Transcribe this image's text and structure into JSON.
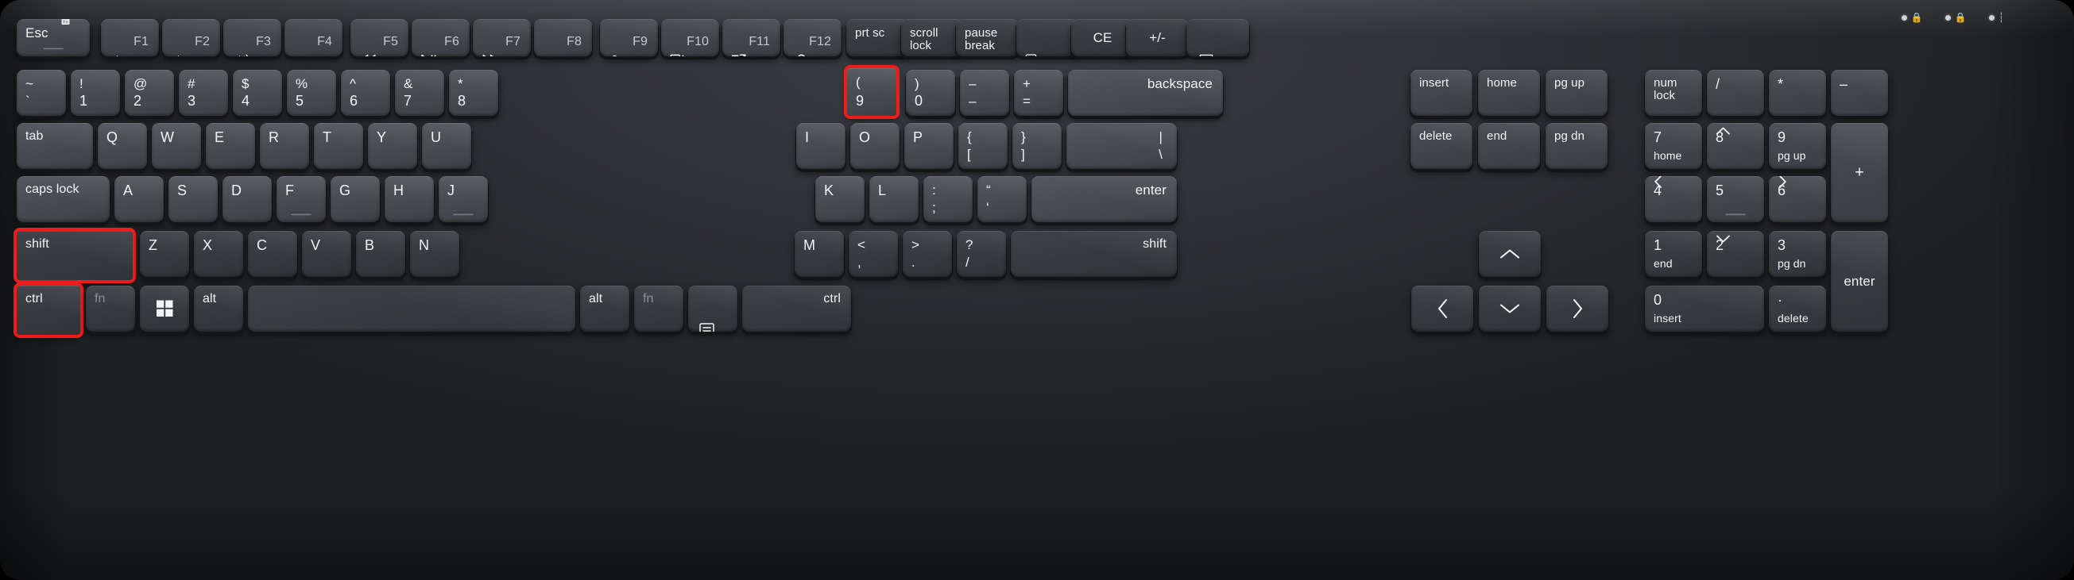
{
  "device": {
    "name": "full-size-desktop-keyboard",
    "layout": "ansi-104-with-numpad",
    "colors": {
      "chassis": "#303338",
      "keycap": "#4a4d53",
      "keycap_bezel": "#141517",
      "legend": "#f2f4f5",
      "legend_dim": "#8d9195",
      "highlight": "#f01c1c",
      "led": "#cfd3d6"
    }
  },
  "indicators": [
    {
      "name": "caps-lock-led",
      "glyph": "lock",
      "lit": false
    },
    {
      "name": "num-lock-led",
      "glyph": "lock",
      "lit": false
    },
    {
      "name": "scroll-lock-led",
      "glyph": "bar",
      "lit": false
    }
  ],
  "highlighted_keys": [
    "9",
    "shift",
    "ctrl"
  ],
  "function_row": [
    {
      "name": "escape",
      "primary": "Esc",
      "secondary": "",
      "icon": "fn-lock-icon",
      "homing": true
    },
    {
      "name": "f1",
      "primary": "",
      "secondary": "F1",
      "icon": "volume-mute-icon"
    },
    {
      "name": "f2",
      "primary": "",
      "secondary": "F2",
      "icon": "volume-down-icon"
    },
    {
      "name": "f3",
      "primary": "",
      "secondary": "F3",
      "icon": "volume-up-icon"
    },
    {
      "name": "f4",
      "primary": "",
      "secondary": "F4",
      "icon": ""
    },
    {
      "name": "f5",
      "primary": "",
      "secondary": "F5",
      "icon": "rewind-icon"
    },
    {
      "name": "f6",
      "primary": "",
      "secondary": "F6",
      "icon": "play-pause-icon"
    },
    {
      "name": "f7",
      "primary": "",
      "secondary": "F7",
      "icon": "fast-forward-icon"
    },
    {
      "name": "f8",
      "primary": "",
      "secondary": "F8",
      "icon": ""
    },
    {
      "name": "f9",
      "primary": "",
      "secondary": "F9",
      "icon": "lock-icon"
    },
    {
      "name": "f10",
      "primary": "",
      "secondary": "F10",
      "icon": "project-panel-icon"
    },
    {
      "name": "f11",
      "primary": "",
      "secondary": "F11",
      "icon": "screen-snip-icon"
    },
    {
      "name": "f12",
      "primary": "",
      "secondary": "F12",
      "icon": "search-icon"
    },
    {
      "name": "print-screen",
      "primary": "prt sc",
      "secondary": "",
      "icon": ""
    },
    {
      "name": "scroll-lock",
      "primary": "scroll\nlock",
      "secondary": "",
      "icon": ""
    },
    {
      "name": "pause-break",
      "primary": "pause\nbreak",
      "secondary": "",
      "icon": ""
    },
    {
      "name": "calculator",
      "primary": "",
      "secondary": "",
      "icon": "calculator-icon"
    },
    {
      "name": "clear-entry",
      "primary": "CE",
      "secondary": "",
      "icon": ""
    },
    {
      "name": "plus-minus",
      "primary": "+/-",
      "secondary": "",
      "icon": ""
    },
    {
      "name": "chat",
      "primary": "",
      "secondary": "",
      "icon": "speech-bubble-icon"
    }
  ],
  "number_row": [
    {
      "name": "grave",
      "shifted": "~",
      "primary": "`"
    },
    {
      "name": "key-1",
      "shifted": "!",
      "primary": "1"
    },
    {
      "name": "key-2",
      "shifted": "@",
      "primary": "2"
    },
    {
      "name": "key-3",
      "shifted": "#",
      "primary": "3"
    },
    {
      "name": "key-4",
      "shifted": "$",
      "primary": "4"
    },
    {
      "name": "key-5",
      "shifted": "%",
      "primary": "5"
    },
    {
      "name": "key-6",
      "shifted": "^",
      "primary": "6"
    },
    {
      "name": "key-7",
      "shifted": "&",
      "primary": "7"
    },
    {
      "name": "key-8",
      "shifted": "*",
      "primary": "8"
    },
    {
      "name": "key-9",
      "shifted": "(",
      "primary": "9",
      "highlighted": true
    },
    {
      "name": "key-0",
      "shifted": ")",
      "primary": "0"
    },
    {
      "name": "minus",
      "shifted": "–",
      "primary": "–"
    },
    {
      "name": "equals",
      "shifted": "+",
      "primary": "="
    },
    {
      "name": "backspace",
      "shifted": "",
      "primary": "backspace"
    }
  ],
  "number_row_nav": [
    {
      "name": "insert",
      "primary": "insert"
    },
    {
      "name": "home",
      "primary": "home"
    },
    {
      "name": "page-up",
      "primary": "pg up"
    }
  ],
  "number_row_numpad": [
    {
      "name": "num-lock",
      "primary": "num\nlock"
    },
    {
      "name": "numpad-divide",
      "primary": "/"
    },
    {
      "name": "numpad-multiply",
      "primary": "*"
    },
    {
      "name": "numpad-subtract",
      "primary": "–"
    }
  ],
  "qwerty_row": [
    {
      "name": "tab",
      "primary": "tab"
    },
    {
      "name": "key-q",
      "primary": "Q"
    },
    {
      "name": "key-w",
      "primary": "W"
    },
    {
      "name": "key-e",
      "primary": "E"
    },
    {
      "name": "key-r",
      "primary": "R"
    },
    {
      "name": "key-t",
      "primary": "T"
    },
    {
      "name": "key-y",
      "primary": "Y"
    },
    {
      "name": "key-u",
      "primary": "U"
    },
    {
      "name": "key-i",
      "primary": "I"
    },
    {
      "name": "key-o",
      "primary": "O"
    },
    {
      "name": "key-p",
      "primary": "P"
    },
    {
      "name": "bracket-left",
      "shifted": "{",
      "primary": "["
    },
    {
      "name": "bracket-right",
      "shifted": "}",
      "primary": "]"
    },
    {
      "name": "backslash",
      "shifted": "|",
      "primary": "\\"
    }
  ],
  "qwerty_row_nav": [
    {
      "name": "delete",
      "primary": "delete"
    },
    {
      "name": "end",
      "primary": "end"
    },
    {
      "name": "page-down",
      "primary": "pg dn"
    }
  ],
  "qwerty_row_numpad": [
    {
      "name": "numpad-7",
      "primary": "7",
      "secondary": "home"
    },
    {
      "name": "numpad-8",
      "primary": "8",
      "secondary": "up-arrow-icon"
    },
    {
      "name": "numpad-9",
      "primary": "9",
      "secondary": "pg up"
    },
    {
      "name": "numpad-add",
      "primary": "+"
    }
  ],
  "home_row": [
    {
      "name": "caps-lock",
      "primary": "caps lock"
    },
    {
      "name": "key-a",
      "primary": "A"
    },
    {
      "name": "key-s",
      "primary": "S"
    },
    {
      "name": "key-d",
      "primary": "D"
    },
    {
      "name": "key-f",
      "primary": "F",
      "homing": true
    },
    {
      "name": "key-g",
      "primary": "G"
    },
    {
      "name": "key-h",
      "primary": "H"
    },
    {
      "name": "key-j",
      "primary": "J",
      "homing": true
    },
    {
      "name": "key-k",
      "primary": "K"
    },
    {
      "name": "key-l",
      "primary": "L"
    },
    {
      "name": "semicolon",
      "shifted": ":",
      "primary": ";"
    },
    {
      "name": "quote",
      "shifted": "“",
      "primary": "‘"
    },
    {
      "name": "enter",
      "primary": "enter"
    }
  ],
  "home_row_numpad": [
    {
      "name": "numpad-4",
      "primary": "4",
      "secondary": "left-arrow-icon"
    },
    {
      "name": "numpad-5",
      "primary": "5",
      "secondary": "",
      "homing": true
    },
    {
      "name": "numpad-6",
      "primary": "6",
      "secondary": "right-arrow-icon"
    }
  ],
  "shift_row": [
    {
      "name": "shift-left",
      "primary": "shift",
      "highlighted": true
    },
    {
      "name": "key-z",
      "primary": "Z"
    },
    {
      "name": "key-x",
      "primary": "X"
    },
    {
      "name": "key-c",
      "primary": "C"
    },
    {
      "name": "key-v",
      "primary": "V"
    },
    {
      "name": "key-b",
      "primary": "B"
    },
    {
      "name": "key-n",
      "primary": "N"
    },
    {
      "name": "key-m",
      "primary": "M"
    },
    {
      "name": "comma",
      "shifted": "<",
      "primary": ","
    },
    {
      "name": "period",
      "shifted": ">",
      "primary": "."
    },
    {
      "name": "slash",
      "shifted": "?",
      "primary": "/"
    },
    {
      "name": "shift-right",
      "primary": "shift"
    }
  ],
  "shift_row_nav": [
    {
      "name": "arrow-up",
      "icon": "up-arrow-icon"
    }
  ],
  "shift_row_numpad": [
    {
      "name": "numpad-1",
      "primary": "1",
      "secondary": "end"
    },
    {
      "name": "numpad-2",
      "primary": "2",
      "secondary": "down-arrow-icon"
    },
    {
      "name": "numpad-3",
      "primary": "3",
      "secondary": "pg dn"
    },
    {
      "name": "numpad-enter",
      "primary": "enter"
    }
  ],
  "bottom_row": [
    {
      "name": "ctrl-left",
      "primary": "ctrl",
      "highlighted": true
    },
    {
      "name": "fn-left",
      "primary": "fn",
      "dim": true
    },
    {
      "name": "windows",
      "primary": "",
      "icon": "windows-icon"
    },
    {
      "name": "alt-left",
      "primary": "alt"
    },
    {
      "name": "space",
      "primary": ""
    },
    {
      "name": "alt-right",
      "primary": "alt"
    },
    {
      "name": "fn-right",
      "primary": "fn",
      "dim": true
    },
    {
      "name": "menu",
      "primary": "",
      "icon": "menu-icon"
    },
    {
      "name": "ctrl-right",
      "primary": "ctrl"
    }
  ],
  "bottom_row_nav": [
    {
      "name": "arrow-left",
      "icon": "left-arrow-icon"
    },
    {
      "name": "arrow-down",
      "icon": "down-arrow-icon"
    },
    {
      "name": "arrow-right",
      "icon": "right-arrow-icon"
    }
  ],
  "bottom_row_numpad": [
    {
      "name": "numpad-0",
      "primary": "0",
      "secondary": "insert"
    },
    {
      "name": "numpad-decimal",
      "primary": "·",
      "secondary": "delete"
    }
  ]
}
